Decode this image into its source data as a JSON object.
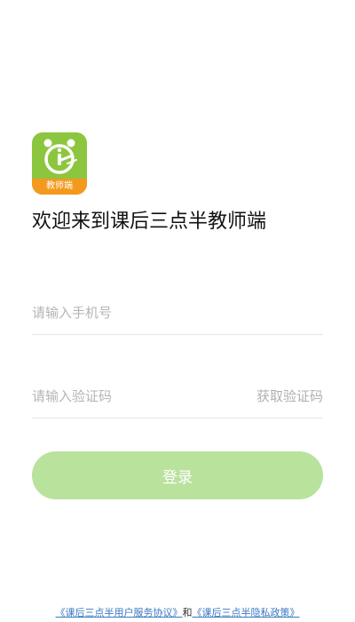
{
  "app": {
    "logo_badge": "教师端",
    "welcome_title": "欢迎来到课后三点半教师端"
  },
  "form": {
    "phone_placeholder": "请输入手机号",
    "code_placeholder": "请输入验证码",
    "get_code_label": "获取验证码",
    "login_label": "登录"
  },
  "footer": {
    "user_agreement": "《课后三点半用户服务协议》",
    "conjunction": "和",
    "privacy_policy": "《课后三点半隐私政策》"
  },
  "colors": {
    "brand_green": "#8cc63f",
    "brand_orange": "#f39a1e",
    "button_disabled": "#b9e29d",
    "link_blue": "#3a78c3"
  },
  "icons": {
    "logo": "alarm-clock-icon"
  }
}
